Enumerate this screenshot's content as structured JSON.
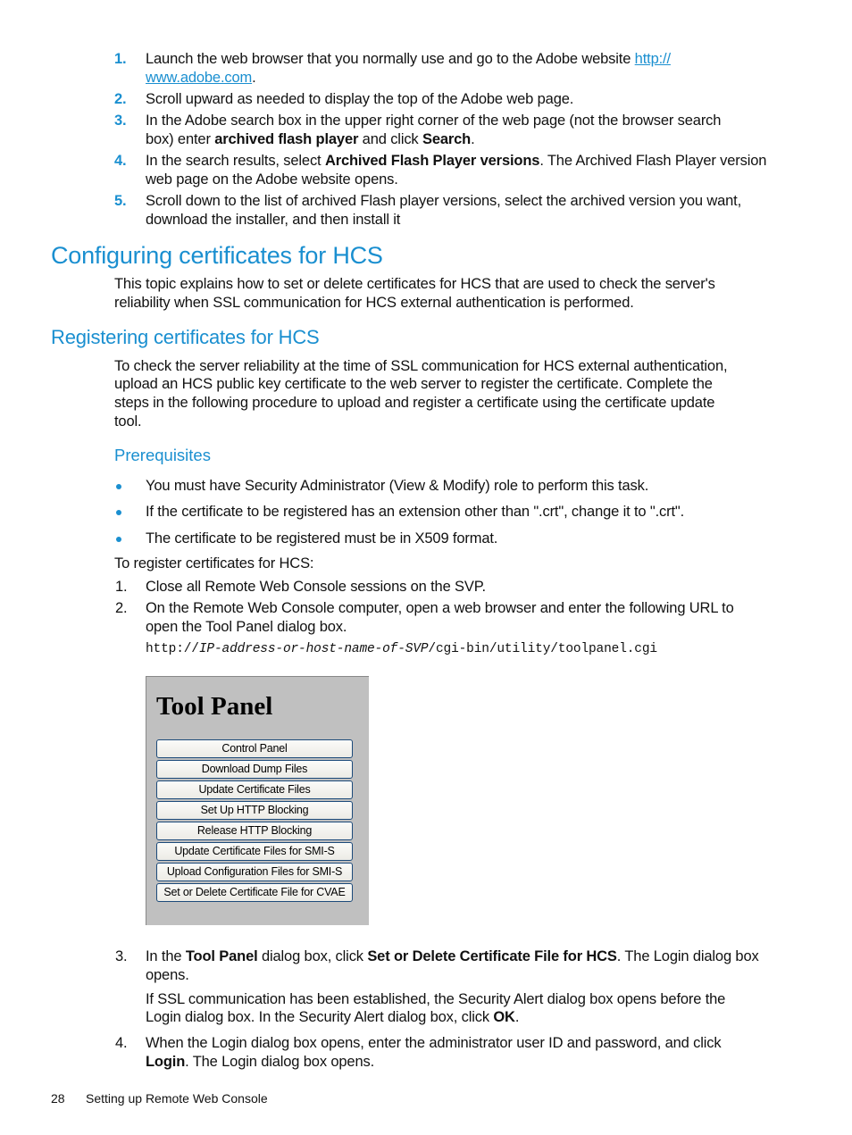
{
  "adobe_steps": [
    {
      "number": "1.",
      "lines": [
        [
          "Launch the web browser that you normally use and go to the Adobe website "
        ],
        [
          ""
        ]
      ],
      "link_part1": "http://",
      "link_part2": "www.adobe.com",
      "after_link": "."
    },
    {
      "number": "2.",
      "text": "Scroll upward as needed to display the top of the Adobe web page."
    },
    {
      "number": "3.",
      "line1": "In the Adobe search box in the upper right corner of the web page (not the browser search",
      "line2_pre": "box) enter ",
      "line2_bold1": "archived flash player",
      "line2_mid": " and click ",
      "line2_bold2": "Search",
      "line2_post": "."
    },
    {
      "number": "4.",
      "line1_pre": "In the search results, select ",
      "line1_bold": "Archived Flash Player versions",
      "line1_post": ". The Archived Flash Player version",
      "line2": "web page on the Adobe website opens."
    },
    {
      "number": "5.",
      "line1": "Scroll down to the list of archived Flash player versions, select the archived version you want,",
      "line2": "download the installer, and then install it"
    }
  ],
  "step1_text": "Launch the web browser that you normally use and go to the Adobe website ",
  "section": {
    "title": "Configuring certificates for HCS",
    "intro_line1": "This topic explains how to set or delete certificates for HCS that are used to check the server's",
    "intro_line2": "reliability when SSL communication for HCS external authentication is performed."
  },
  "subsection": {
    "title": "Registering certificates for HCS",
    "para_lines": [
      "To check the server reliability at the time of SSL communication for HCS external authentication,",
      "upload an HCS public key certificate to the web server to register the certificate. Complete the",
      "steps in the following procedure to upload and register a certificate using the certificate update",
      "tool."
    ],
    "prereq_title": "Prerequisites",
    "prereqs": [
      "You must have Security Administrator (View & Modify) role to perform this task.",
      "If the certificate to be registered has an extension other than \".crt\", change it to \".crt\".",
      "The certificate to be registered must be in X509 format."
    ],
    "procedure_intro": "To register certificates for HCS:",
    "steps": {
      "s1": {
        "number": "1.",
        "text": "Close all Remote Web Console sessions on the SVP."
      },
      "s2": {
        "number": "2.",
        "line1": "On the Remote Web Console computer, open a web browser and enter the following URL to",
        "line2": "open the Tool Panel dialog box."
      },
      "url": {
        "prefix": "http://",
        "italic": "IP-address-or-host-name-of-SVP",
        "suffix": "/cgi-bin/utility/toolpanel.cgi"
      },
      "s3": {
        "number": "3.",
        "pre": "In the ",
        "bold1": "Tool Panel",
        "mid": " dialog box, click ",
        "bold2": "Set or Delete Certificate File for HCS",
        "post": ". The Login dialog box",
        "line2": "opens.",
        "note_line1": "If SSL communication has been established, the Security Alert dialog box opens before the",
        "note_line2_pre": "Login dialog box. In the Security Alert dialog box, click ",
        "note_bold": "OK",
        "note_post": "."
      },
      "s4": {
        "number": "4.",
        "line1": "When the Login dialog box opens, enter the administrator user ID and password, and click",
        "line2_bold": "Login",
        "line2_post": ". The Login dialog box opens."
      }
    }
  },
  "tool_panel": {
    "title": "Tool Panel",
    "buttons": [
      "Control Panel",
      "Download Dump Files",
      "Update Certificate Files",
      "Set Up HTTP Blocking",
      "Release HTTP Blocking",
      "Update Certificate Files for SMI-S",
      "Upload Configuration Files for SMI-S",
      "Set or Delete Certificate File for CVAE"
    ]
  },
  "footer": {
    "page_number": "28",
    "section_title": "Setting up Remote Web Console"
  },
  "colors": {
    "accent": "#1a8fd0",
    "panel_bg": "#c0c0c0",
    "button_border": "#1c4a7a"
  }
}
